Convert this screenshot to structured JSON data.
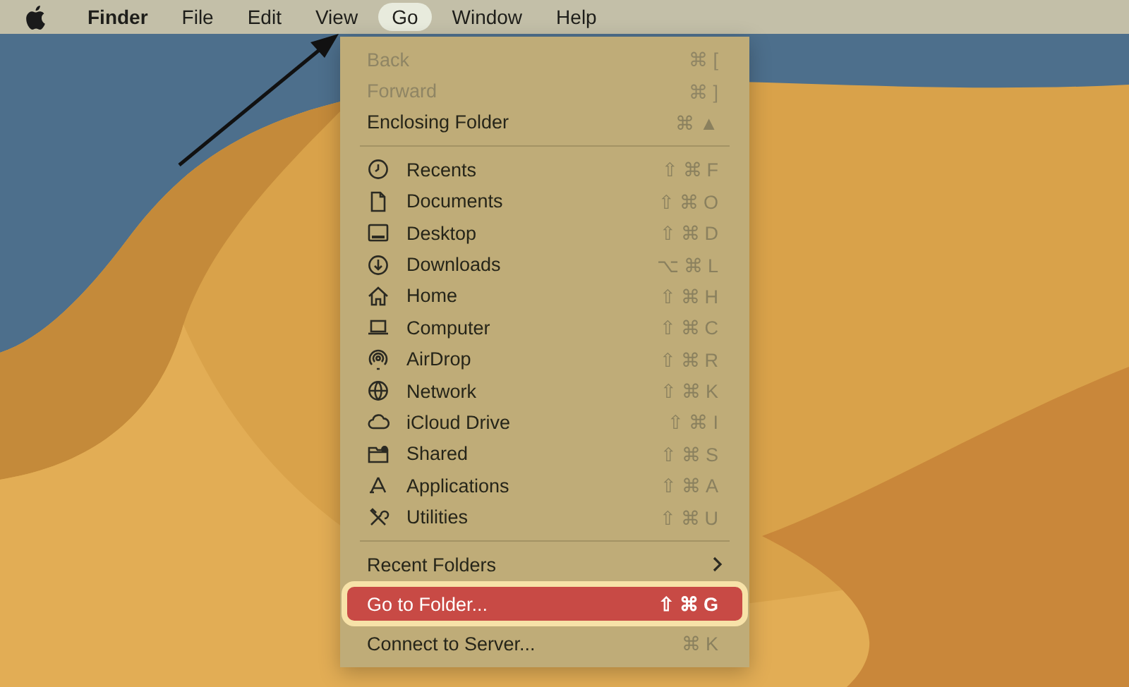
{
  "menu_bar": [
    {
      "label": "Finder",
      "kind": "app",
      "selected": false
    },
    {
      "label": "File",
      "kind": "menu",
      "selected": false
    },
    {
      "label": "Edit",
      "kind": "menu",
      "selected": false
    },
    {
      "label": "View",
      "kind": "menu",
      "selected": false
    },
    {
      "label": "Go",
      "kind": "menu",
      "selected": true
    },
    {
      "label": "Window",
      "kind": "menu",
      "selected": false
    },
    {
      "label": "Help",
      "kind": "menu",
      "selected": false
    }
  ],
  "go_menu": {
    "groups": [
      {
        "items": [
          {
            "label": "Back",
            "shortcut": "⌘[",
            "disabled": true,
            "selected": false,
            "kind": "item"
          },
          {
            "label": "Forward",
            "shortcut": "⌘]",
            "disabled": true,
            "selected": false,
            "kind": "item"
          },
          {
            "label": "Enclosing Folder",
            "shortcut": "⌘▲",
            "disabled": false,
            "selected": false,
            "kind": "item"
          }
        ]
      },
      {
        "items": [
          {
            "label": "Recents",
            "shortcut": "⇧⌘F",
            "disabled": false,
            "selected": false,
            "kind": "item"
          },
          {
            "label": "Documents",
            "shortcut": "⇧⌘O",
            "disabled": false,
            "selected": false,
            "kind": "item"
          },
          {
            "label": "Desktop",
            "shortcut": "⇧⌘D",
            "disabled": false,
            "selected": false,
            "kind": "item"
          },
          {
            "label": "Downloads",
            "shortcut": "⌥⌘L",
            "disabled": false,
            "selected": false,
            "kind": "item"
          },
          {
            "label": "Home",
            "shortcut": "⇧⌘H",
            "disabled": false,
            "selected": false,
            "kind": "item"
          },
          {
            "label": "Computer",
            "shortcut": "⇧⌘C",
            "disabled": false,
            "selected": false,
            "kind": "item"
          },
          {
            "label": "AirDrop",
            "shortcut": "⇧⌘R",
            "disabled": false,
            "selected": false,
            "kind": "item"
          },
          {
            "label": "Network",
            "shortcut": "⇧⌘K",
            "disabled": false,
            "selected": false,
            "kind": "item"
          },
          {
            "label": "iCloud Drive",
            "shortcut": "⇧⌘I",
            "disabled": false,
            "selected": false,
            "kind": "item"
          },
          {
            "label": "Shared",
            "shortcut": "⇧⌘S",
            "disabled": false,
            "selected": false,
            "kind": "item"
          },
          {
            "label": "Applications",
            "shortcut": "⇧⌘A",
            "disabled": false,
            "selected": false,
            "kind": "item"
          },
          {
            "label": "Utilities",
            "shortcut": "⇧⌘U",
            "disabled": false,
            "selected": false,
            "kind": "item"
          }
        ]
      },
      {
        "items": [
          {
            "label": "Recent Folders",
            "disabled": false,
            "selected": false,
            "kind": "submenu"
          },
          {
            "label": "Go to Folder...",
            "shortcut": "⇧⌘G",
            "disabled": false,
            "selected": true,
            "kind": "item"
          },
          {
            "label": "Connect to Server...",
            "shortcut": "⌘K",
            "disabled": false,
            "selected": false,
            "kind": "item"
          }
        ]
      }
    ]
  }
}
